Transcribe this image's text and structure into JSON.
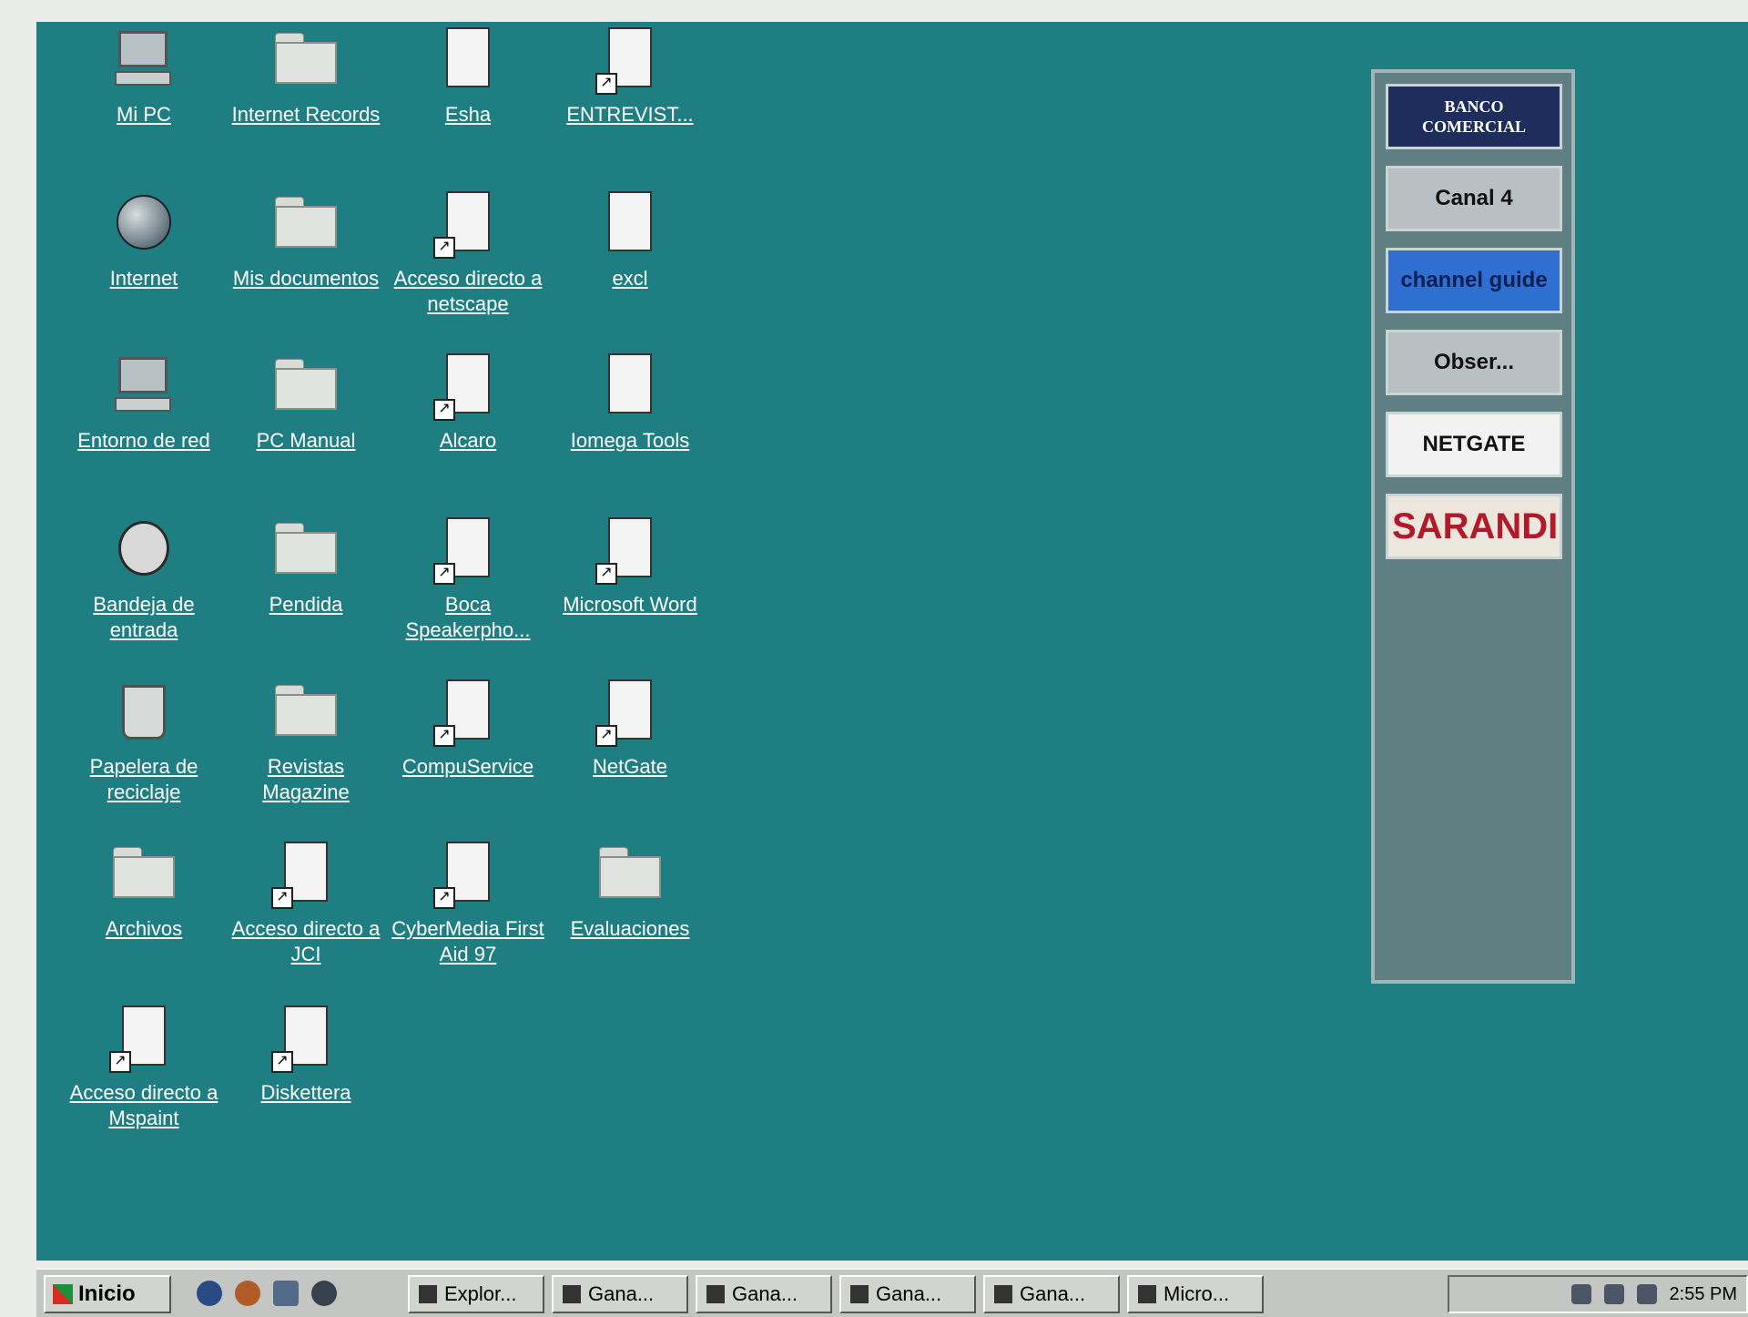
{
  "desktop": {
    "icons": [
      {
        "label": "Mi PC",
        "icon": "computer-icon"
      },
      {
        "label": "Internet Records",
        "icon": "folder-icon"
      },
      {
        "label": "Esha",
        "icon": "document-icon"
      },
      {
        "label": "ENTREVIST...",
        "icon": "document-shortcut-icon"
      },
      {
        "label": "Internet",
        "icon": "globe-icon"
      },
      {
        "label": "Mis documentos",
        "icon": "folder-icon"
      },
      {
        "label": "Acceso directo a netscape",
        "icon": "netscape-shortcut-icon"
      },
      {
        "label": "excl",
        "icon": "application-icon"
      },
      {
        "label": "Entorno de red",
        "icon": "network-icon"
      },
      {
        "label": "PC Manual",
        "icon": "folder-icon"
      },
      {
        "label": "Alcaro",
        "icon": "document-shortcut-icon"
      },
      {
        "label": "Iomega Tools",
        "icon": "tools-icon"
      },
      {
        "label": "Bandeja de entrada",
        "icon": "inbox-icon"
      },
      {
        "label": "Pendida",
        "icon": "folder-icon"
      },
      {
        "label": "Boca Speakerpho...",
        "icon": "document-shortcut-icon"
      },
      {
        "label": "Microsoft Word",
        "icon": "word-shortcut-icon"
      },
      {
        "label": "Papelera de reciclaje",
        "icon": "recycle-bin-icon"
      },
      {
        "label": "Revistas Magazine",
        "icon": "folder-icon"
      },
      {
        "label": "CompuService",
        "icon": "compuserve-shortcut-icon"
      },
      {
        "label": "NetGate",
        "icon": "netgate-shortcut-icon"
      },
      {
        "label": "Archivos",
        "icon": "folder-icon"
      },
      {
        "label": "Acceso directo a JCI",
        "icon": "drive-shortcut-icon"
      },
      {
        "label": "CyberMedia First Aid 97",
        "icon": "first-aid-shortcut-icon"
      },
      {
        "label": "Evaluaciones",
        "icon": "folder-icon"
      },
      {
        "label": "Acceso directo a Mspaint",
        "icon": "paint-shortcut-icon"
      },
      {
        "label": "Diskettera",
        "icon": "floppy-shortcut-icon"
      }
    ]
  },
  "channel_bar": {
    "channels": [
      {
        "label": "BANCO COMERCIAL",
        "bg": "#1f2d5c",
        "fg": "#ffffff"
      },
      {
        "label": "Canal 4",
        "bg": "#b9c0c3",
        "fg": "#111111"
      },
      {
        "label": "channel guide",
        "bg": "#2f6fd0",
        "fg": "#0b1f55"
      },
      {
        "label": "Obser...",
        "bg": "#b9c0c3",
        "fg": "#111111"
      },
      {
        "label": "NETGATE",
        "bg": "#f2f2f2",
        "fg": "#111111"
      },
      {
        "label": "SARANDI",
        "bg": "#ece6dc",
        "fg": "#b2192a"
      }
    ]
  },
  "taskbar": {
    "start_label": "Inicio",
    "tasks": [
      {
        "label": "Explor..."
      },
      {
        "label": "Gana..."
      },
      {
        "label": "Gana..."
      },
      {
        "label": "Gana..."
      },
      {
        "label": "Gana..."
      },
      {
        "label": "Micro..."
      }
    ],
    "clock": "2:55 PM"
  },
  "colors": {
    "desktop": "#1f7e82",
    "taskbar": "#c3c6c2"
  }
}
